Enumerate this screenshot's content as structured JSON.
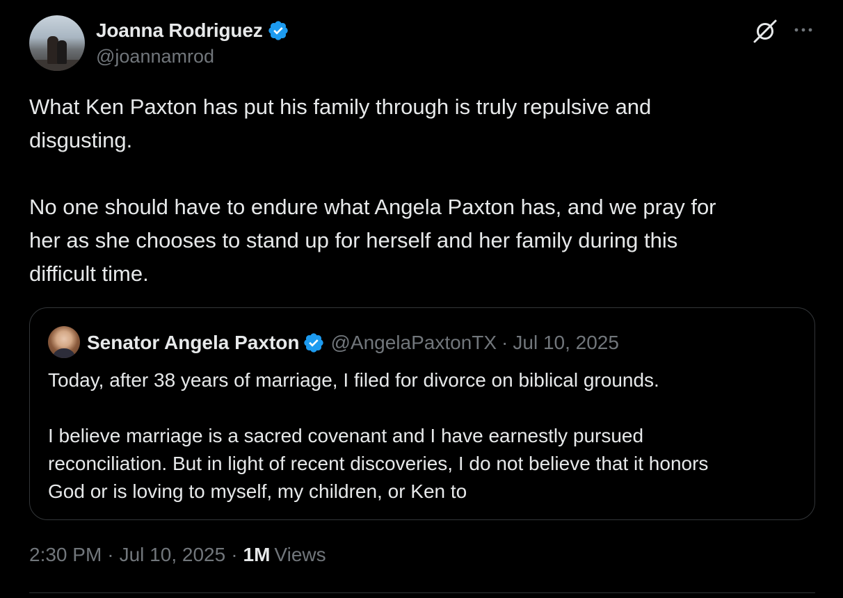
{
  "author": {
    "display_name": "Joanna Rodriguez",
    "handle": "@joannamrod",
    "verified": true
  },
  "icons": {
    "verified": "verified-badge-icon",
    "grok": "grok-icon",
    "more": "more-options-icon"
  },
  "tweet": {
    "text": "What Ken Paxton has put his family through is truly repulsive and\ndisgusting.\n\nNo one should have to endure what Angela Paxton has, and we pray for\nher as she chooses to stand up for herself and her family during this\ndifficult time."
  },
  "quoted_tweet": {
    "display_name": "Senator Angela Paxton",
    "handle": "@AngelaPaxtonTX",
    "separator": "·",
    "date": "Jul 10, 2025",
    "verified": true,
    "text": "Today, after 38 years of marriage, I filed for divorce on biblical grounds.\n\nI believe marriage is a sacred covenant and I have earnestly pursued\nreconciliation. But in light of recent discoveries, I do not believe that it honors\nGod or is loving to myself, my children, or Ken to"
  },
  "meta": {
    "time": "2:30 PM",
    "separator": "·",
    "date": "Jul 10, 2025",
    "views_count": "1M",
    "views_label": "Views"
  },
  "colors": {
    "background": "#000000",
    "text_primary": "#e7e9ea",
    "text_secondary": "#71767b",
    "verified_blue": "#1d9bf0",
    "border": "#333639"
  }
}
